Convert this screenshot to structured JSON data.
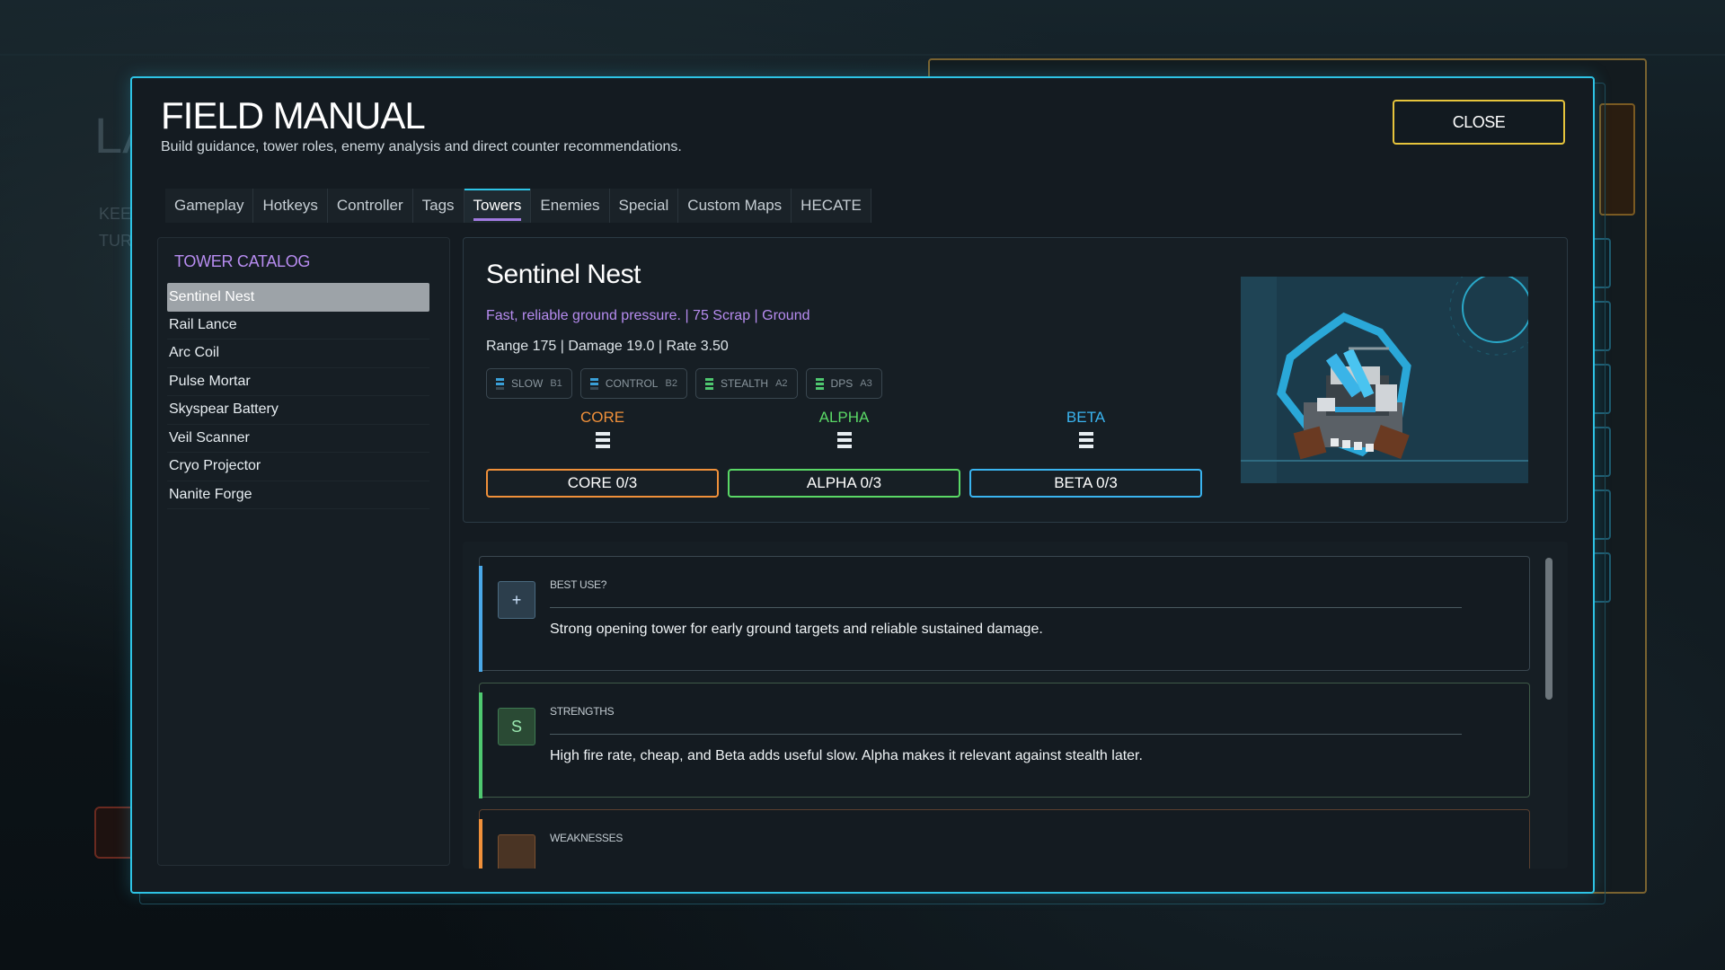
{
  "background": {
    "letters_large": "LA",
    "letters_small_1": "KEE",
    "letters_small_2": "TUR"
  },
  "modal": {
    "title": "FIELD MANUAL",
    "subtitle": "Build guidance, tower roles, enemy analysis and direct counter recommendations.",
    "close_label": "CLOSE"
  },
  "tabs": [
    {
      "label": "Gameplay"
    },
    {
      "label": "Hotkeys"
    },
    {
      "label": "Controller"
    },
    {
      "label": "Tags"
    },
    {
      "label": "Towers",
      "active": true
    },
    {
      "label": "Enemies"
    },
    {
      "label": "Special"
    },
    {
      "label": "Custom Maps"
    },
    {
      "label": "HECATE"
    }
  ],
  "catalog": {
    "title": "TOWER CATALOG",
    "selected_index": 0,
    "items": [
      {
        "label": "Sentinel Nest"
      },
      {
        "label": "Rail Lance"
      },
      {
        "label": "Arc Coil"
      },
      {
        "label": "Pulse Mortar"
      },
      {
        "label": "Skyspear Battery"
      },
      {
        "label": "Veil Scanner"
      },
      {
        "label": "Cryo Projector"
      },
      {
        "label": "Nanite Forge"
      }
    ]
  },
  "tower": {
    "name": "Sentinel Nest",
    "tagline": "Fast, reliable ground pressure. | 75 Scrap | Ground",
    "stats": "Range 175 | Damage 19.0 | Rate 3.50",
    "chips": [
      {
        "label": "SLOW",
        "grade": "B1",
        "color": "#3aa0d8"
      },
      {
        "label": "CONTROL",
        "grade": "B2",
        "color": "#3aa0d8"
      },
      {
        "label": "STEALTH",
        "grade": "A2",
        "color": "#4fc870"
      },
      {
        "label": "DPS",
        "grade": "A3",
        "color": "#4fc870"
      }
    ],
    "branches": [
      {
        "label": "CORE",
        "button": "CORE 0/3",
        "color": "#f0903a"
      },
      {
        "label": "ALPHA",
        "button": "ALPHA 0/3",
        "color": "#5ad866"
      },
      {
        "label": "BETA",
        "button": "BETA 0/3",
        "color": "#3ab4f0"
      }
    ]
  },
  "cards": [
    {
      "icon": "+",
      "label": "BEST USE?",
      "text": "Strong opening tower for early ground targets and reliable sustained damage.",
      "accent": "#4aa8e8",
      "icon_bg": "#2c3e4c",
      "icon_color": "#cfe6ff"
    },
    {
      "icon": "S",
      "label": "STRENGTHS",
      "text": "High fire rate, cheap, and Beta adds useful slow. Alpha makes it relevant against stealth later.",
      "accent": "#4fc870",
      "icon_bg": "#2a4a34",
      "icon_color": "#9ae8b0"
    },
    {
      "icon": "",
      "label": "WEAKNESSES",
      "text": "",
      "accent": "#f0903a",
      "icon_bg": "#4a3424",
      "icon_color": "#f0c090"
    }
  ]
}
